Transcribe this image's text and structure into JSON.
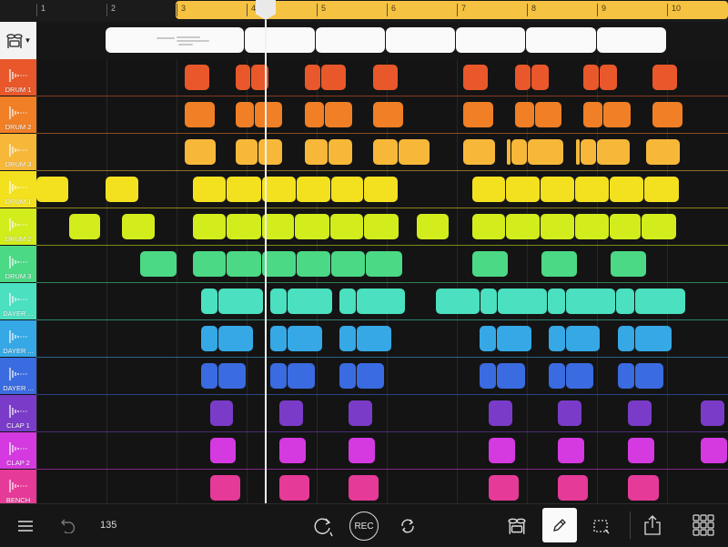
{
  "ruler": {
    "bars": [
      "1",
      "2",
      "3",
      "4",
      "5",
      "6",
      "7",
      "8",
      "9",
      "10"
    ],
    "loop_color": "#f5c242"
  },
  "tracks": [
    {
      "name": "DRUM 1",
      "color": "#e8582a"
    },
    {
      "name": "DRUM 2",
      "color": "#f07f26"
    },
    {
      "name": "DRUM 3",
      "color": "#f7b83a"
    },
    {
      "name": "DRUM 1",
      "color": "#f3e11f"
    },
    {
      "name": "DRUM 2",
      "color": "#d3ec1c"
    },
    {
      "name": "DRUM 3",
      "color": "#4bd986"
    },
    {
      "name": "DAYER ...",
      "color": "#4be0c0"
    },
    {
      "name": "DAYER ...",
      "color": "#36a8e6"
    },
    {
      "name": "DAYER ...",
      "color": "#3a6be0"
    },
    {
      "name": "CLAP 1",
      "color": "#7a3cc8"
    },
    {
      "name": "CLAP 2",
      "color": "#d43ae0"
    },
    {
      "name": "BENCH",
      "color": "#e63a98"
    }
  ],
  "toolbar": {
    "tempo": "135",
    "rec_label": "REC"
  },
  "icons": [
    "menu-icon",
    "undo-icon",
    "loop-playback-icon",
    "redo-repeat-icon",
    "drum-kit-icon",
    "pencil-icon",
    "select-icon",
    "share-icon",
    "grid-apps-icon"
  ]
}
